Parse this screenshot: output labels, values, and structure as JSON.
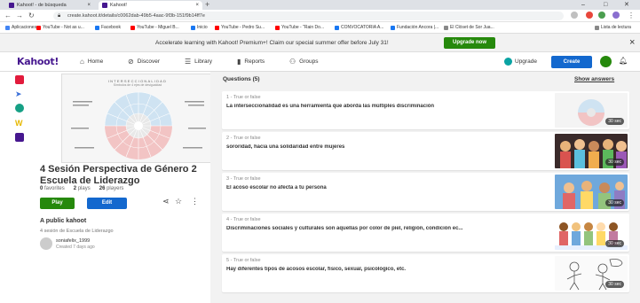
{
  "browser": {
    "tabs": [
      {
        "label": "Kahoot! - de búsqueda"
      },
      {
        "label": "Kahoot!"
      }
    ],
    "url": "create.kahoot.it/details/c0062dab-49b5-4aac-9f3b-151f9b14ff7e",
    "bookmarks": [
      {
        "label": "Aplicaciones",
        "color": "#4285f4"
      },
      {
        "label": "YouTube - Not as u...",
        "color": "#ff0000"
      },
      {
        "label": "Facebook",
        "color": "#1877f2"
      },
      {
        "label": "YouTube - Miguel B...",
        "color": "#ff0000"
      },
      {
        "label": "Inicio",
        "color": "#1877f2"
      },
      {
        "label": "YouTube - Pedro Su...",
        "color": "#ff0000"
      },
      {
        "label": "YouTube - \"Rain Do...",
        "color": "#ff0000"
      },
      {
        "label": "CONVOCATORIA A...",
        "color": "#1877f2"
      },
      {
        "label": "Fundación Ancora |...",
        "color": "#1877f2"
      },
      {
        "label": "El Clóset de Sor Jua...",
        "color": "#888888"
      },
      {
        "label": "Lista de lectura",
        "color": "#888888"
      }
    ]
  },
  "banner": {
    "text": "Accelerate learning with Kahoot! Premium+! Claim our special summer offer before July 31!",
    "button": "Upgrade now",
    "close": "×"
  },
  "nav": {
    "logo": "Kahoot!",
    "items": [
      {
        "label": "Home",
        "icon": "⌂"
      },
      {
        "label": "Discover",
        "icon": "⊘"
      },
      {
        "label": "Library",
        "icon": "☰"
      },
      {
        "label": "Reports",
        "icon": "▮"
      },
      {
        "label": "Groups",
        "icon": "⚇"
      }
    ],
    "upgrade": "Upgrade",
    "create": "Create"
  },
  "kahoot": {
    "cover_title": "INTERSECCIONALIDAD",
    "cover_subtitle": "Símbolos de 4 ejes de desigualdad",
    "title": "4 Sesión Perspectiva de Género 2 Escuela de Liderazgo",
    "favorites_count": "0",
    "favorites_label": "favorites",
    "plays_count": "2",
    "plays_label": "plays",
    "players_count": "26",
    "players_label": "players",
    "play_button": "Play",
    "edit_button": "Edit",
    "visibility": "A public kahoot",
    "description": "4 sesión de Escuela de Liderazgo",
    "creator": "soniafelix_1999",
    "created": "Created 7 days ago"
  },
  "questions": {
    "heading": "Questions (5)",
    "show_answers": "Show answers",
    "items": [
      {
        "type": "1 - True or false",
        "text": "La interseccionalidad es una herramienta que aborda las múltiples discriminación",
        "time": "30 sec"
      },
      {
        "type": "2 - True or false",
        "text": "sororidad, hacia una solidaridad entre mujeres",
        "time": "30 sec"
      },
      {
        "type": "3 - True or false",
        "text": "El acoso escolar no afecta a tu persona",
        "time": "30 sec"
      },
      {
        "type": "4 - True or false",
        "text": "Discriminaciones sociales y culturales son aquellas por color de piel, religión, condición ec...",
        "time": "30 sec"
      },
      {
        "type": "5 - True or false",
        "text": "Hay diferentes tipos de acosos escolar, físico, sexual, psicológico, etc.",
        "time": "30 sec"
      }
    ]
  },
  "colors": {
    "kahoot_purple": "#46178f",
    "green": "#26890c",
    "blue": "#1368ce",
    "question_bg": "#f2f2f2"
  }
}
